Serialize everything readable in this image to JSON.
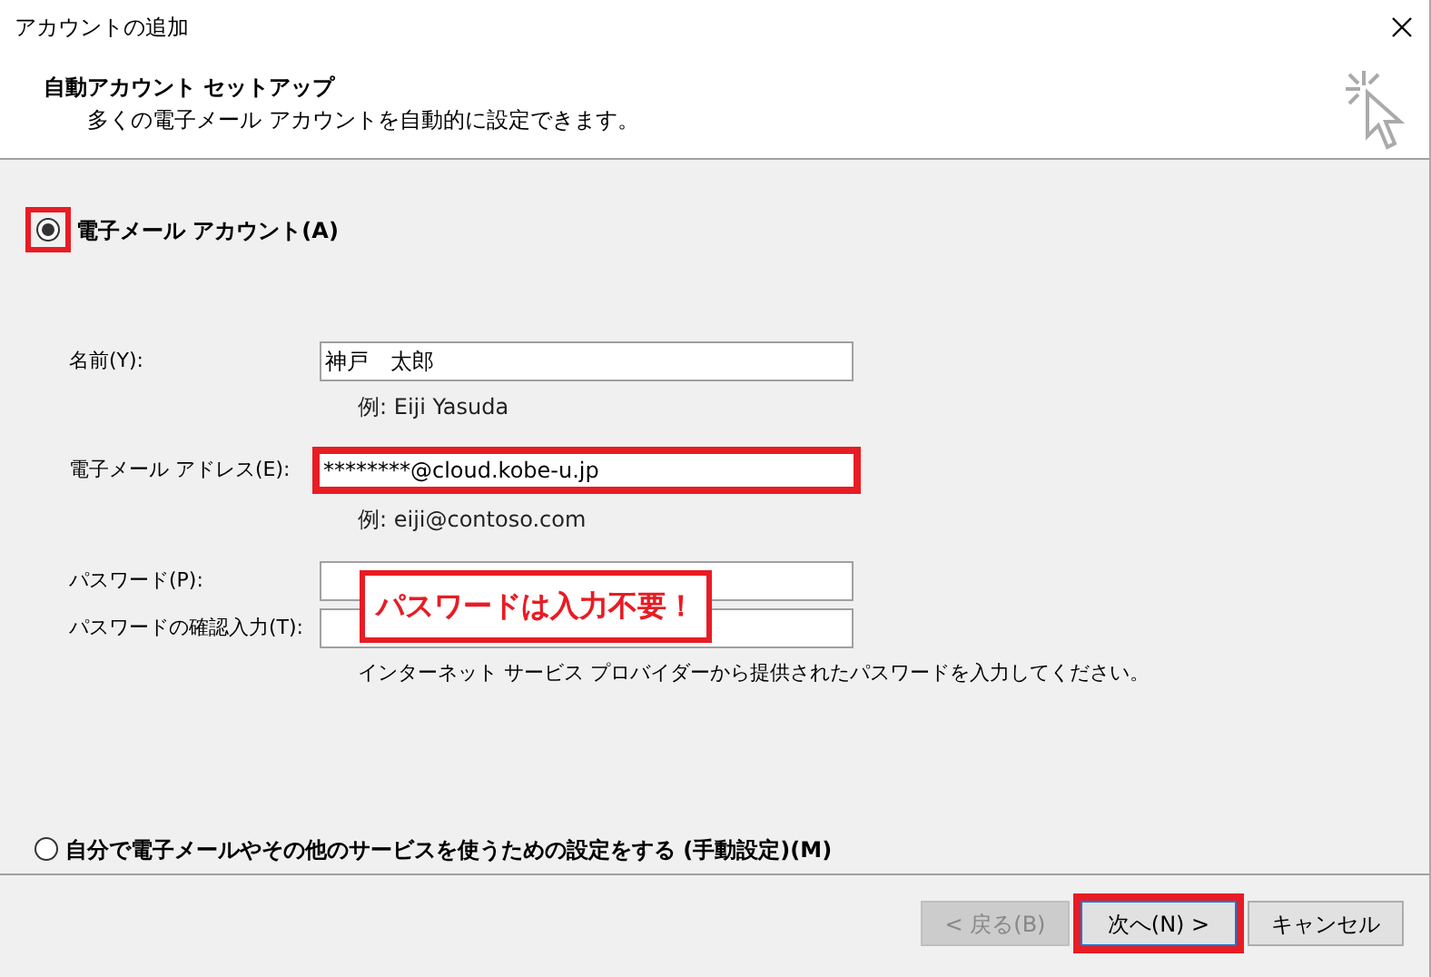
{
  "window": {
    "title": "アカウントの追加"
  },
  "header": {
    "title": "自動アカウント セットアップ",
    "subtitle": "多くの電子メール アカウントを自動的に設定できます。"
  },
  "options": [
    {
      "label": "電子メール アカウント(A)",
      "selected": true,
      "highlighted": true
    },
    {
      "label": "自分で電子メールやその他のサービスを使うための設定をする (手動設定)(M)",
      "selected": false,
      "highlighted": false
    }
  ],
  "fields": [
    {
      "label": "名前(Y):",
      "value": "神戸　太郎",
      "hint": "例: Eiji Yasuda",
      "highlighted": false
    },
    {
      "label": "電子メール アドレス(E):",
      "value": "********@cloud.kobe-u.jp",
      "hint": "例: eiji@contoso.com",
      "highlighted": true
    },
    {
      "label": "パスワード(P):",
      "highlighted": false
    },
    {
      "label": "パスワードの確認入力(T):",
      "highlighted": false
    }
  ],
  "password_note": "インターネット サービス プロバイダーから提供されたパスワードを入力してください。",
  "callout": "パスワードは入力不要！",
  "buttons": [
    {
      "label": "< 戻る(B)",
      "disabled": true,
      "highlighted": false
    },
    {
      "label": "次へ(N) >",
      "disabled": false,
      "highlighted": true
    },
    {
      "label": "キャンセル",
      "disabled": false,
      "highlighted": false
    }
  ]
}
